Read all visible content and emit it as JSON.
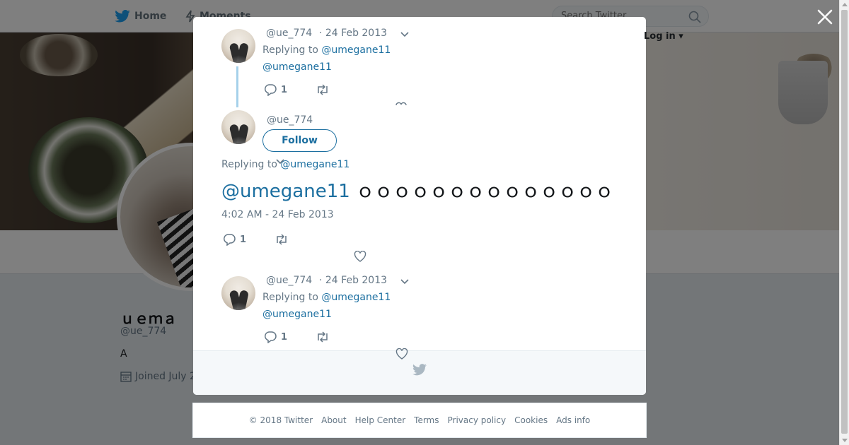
{
  "nav": {
    "home": "Home",
    "moments": "Moments",
    "search_placeholder": "Search Twitter",
    "login": "Log in"
  },
  "profile": {
    "name": "ｕｅｍａ",
    "handle": "@ue_774",
    "bio": "A",
    "joined": "Joined July 2"
  },
  "modal": {
    "tweet1": {
      "handle": "@ue_774",
      "date": "· 24 Feb 2013",
      "reply_prefix": "Replying to",
      "reply_to": "@umegane11",
      "text": "@umegane11",
      "reply_count": "1"
    },
    "main": {
      "handle": "@ue_774",
      "follow_label": "Follow",
      "reply_prefix": "Replying to",
      "reply_to": "@umegane11",
      "mention": "@umegane11",
      "body": "ｏｏｏｏｏｏｏｏｏｏｏｏｏｏ",
      "timestamp": "4:02 AM - 24 Feb 2013",
      "reply_count": "1"
    },
    "tweet3": {
      "handle": "@ue_774",
      "date": "· 24 Feb 2013",
      "reply_prefix": "Replying to",
      "reply_to": "@umegane11",
      "text": "@umegane11",
      "reply_count": "1"
    }
  },
  "footer": {
    "links": [
      "© 2018 Twitter",
      "About",
      "Help Center",
      "Terms",
      "Privacy policy",
      "Cookies",
      "Ads info"
    ]
  },
  "colors": {
    "link": "#1c6fa0",
    "muted": "#657786",
    "thread_line": "#a5d1ea"
  }
}
